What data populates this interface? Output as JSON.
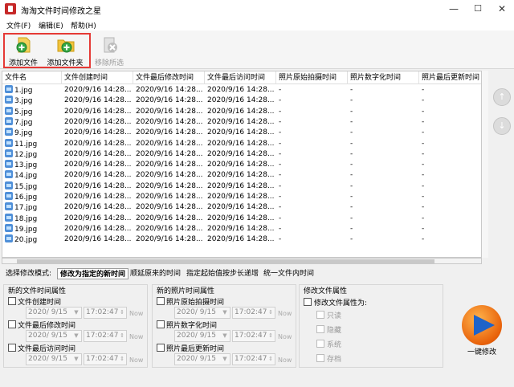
{
  "window": {
    "title": "淘淘文件时间修改之星",
    "min": "—",
    "max": "☐",
    "close": "✕"
  },
  "menu": [
    "文件(F)",
    "编辑(E)",
    "帮助(H)"
  ],
  "toolbar": {
    "add_file": "添加文件",
    "add_folder": "添加文件夹",
    "remove": "移除所选"
  },
  "colors": {
    "highlight": "#e53935",
    "apply_orange": "#e8610a",
    "apply_blue": "#1e63c9"
  },
  "table": {
    "columns": [
      "文件名",
      "文件创建时间",
      "文件最后修改时间",
      "文件最后访问时间",
      "照片原始拍摄时间",
      "照片数字化时间",
      "照片最后更新时间"
    ],
    "rows": [
      [
        "1.jpg",
        "2020/9/16 14:28...",
        "2020/9/16 14:28...",
        "2020/9/16 14:28...",
        "-",
        "-",
        "-"
      ],
      [
        "3.jpg",
        "2020/9/16 14:28...",
        "2020/9/16 14:28...",
        "2020/9/16 14:28...",
        "-",
        "-",
        "-"
      ],
      [
        "5.jpg",
        "2020/9/16 14:28...",
        "2020/9/16 14:28...",
        "2020/9/16 14:28...",
        "-",
        "-",
        "-"
      ],
      [
        "7.jpg",
        "2020/9/16 14:28...",
        "2020/9/16 14:28...",
        "2020/9/16 14:28...",
        "-",
        "-",
        "-"
      ],
      [
        "9.jpg",
        "2020/9/16 14:28...",
        "2020/9/16 14:28...",
        "2020/9/16 14:28...",
        "-",
        "-",
        "-"
      ],
      [
        "11.jpg",
        "2020/9/16 14:28...",
        "2020/9/16 14:28...",
        "2020/9/16 14:28...",
        "-",
        "-",
        "-"
      ],
      [
        "12.jpg",
        "2020/9/16 14:28...",
        "2020/9/16 14:28...",
        "2020/9/16 14:28...",
        "-",
        "-",
        "-"
      ],
      [
        "13.jpg",
        "2020/9/16 14:28...",
        "2020/9/16 14:28...",
        "2020/9/16 14:28...",
        "-",
        "-",
        "-"
      ],
      [
        "14.jpg",
        "2020/9/16 14:28...",
        "2020/9/16 14:28...",
        "2020/9/16 14:28...",
        "-",
        "-",
        "-"
      ],
      [
        "15.jpg",
        "2020/9/16 14:28...",
        "2020/9/16 14:28...",
        "2020/9/16 14:28...",
        "-",
        "-",
        "-"
      ],
      [
        "16.jpg",
        "2020/9/16 14:28...",
        "2020/9/16 14:28...",
        "2020/9/16 14:28...",
        "-",
        "-",
        "-"
      ],
      [
        "17.jpg",
        "2020/9/16 14:28...",
        "2020/9/16 14:28...",
        "2020/9/16 14:28...",
        "-",
        "-",
        "-"
      ],
      [
        "18.jpg",
        "2020/9/16 14:28...",
        "2020/9/16 14:28...",
        "2020/9/16 14:28...",
        "-",
        "-",
        "-"
      ],
      [
        "19.jpg",
        "2020/9/16 14:28...",
        "2020/9/16 14:28...",
        "2020/9/16 14:28...",
        "-",
        "-",
        "-"
      ],
      [
        "20.jpg",
        "2020/9/16 14:28...",
        "2020/9/16 14:28...",
        "2020/9/16 14:28...",
        "-",
        "-",
        "-"
      ]
    ]
  },
  "move_buttons": {
    "up": "↑",
    "down": "↓"
  },
  "mode": {
    "label": "选择修改模式:",
    "options": [
      "修改为指定的新时间",
      "顺延原来的时间",
      "指定起始值按步长递增",
      "统一文件内时间"
    ],
    "active": "修改为指定的新时间"
  },
  "file_group": {
    "title": "新的文件时间属性",
    "items": [
      {
        "label": "文件创建时间",
        "date": "2020/ 9/15",
        "time": "17:02:47",
        "now": "Now"
      },
      {
        "label": "文件最后修改时间",
        "date": "2020/ 9/15",
        "time": "17:02:47",
        "now": "Now"
      },
      {
        "label": "文件最后访问时间",
        "date": "2020/ 9/15",
        "time": "17:02:47",
        "now": "Now"
      }
    ]
  },
  "photo_group": {
    "title": "新的照片时间属性",
    "items": [
      {
        "label": "照片原始拍摄时间",
        "date": "2020/ 9/15",
        "time": "17:02:47",
        "now": "Now"
      },
      {
        "label": "照片数字化时间",
        "date": "2020/ 9/15",
        "time": "17:02:47",
        "now": "Now"
      },
      {
        "label": "照片最后更新时间",
        "date": "2020/ 9/15",
        "time": "17:02:47",
        "now": "Now"
      }
    ]
  },
  "attr_group": {
    "title": "修改文件属性",
    "modify_label": "修改文件属性为:",
    "attrs": [
      "只读",
      "隐藏",
      "系统",
      "存档"
    ]
  },
  "apply": {
    "label": "一键修改"
  }
}
